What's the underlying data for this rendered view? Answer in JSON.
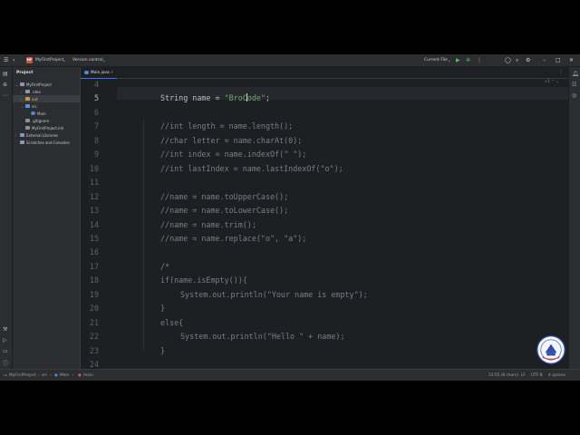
{
  "titlebar": {
    "project_badge": "MF",
    "project_name": "MyFirstProject",
    "vcs": "Version control",
    "run_config": "Current File"
  },
  "project_panel": {
    "title": "Project",
    "tree": [
      {
        "label": "MyFirstProject",
        "depth": 0,
        "arrow": "open",
        "icon": "folder-icon",
        "color": "#8a97b0"
      },
      {
        "label": ".idea",
        "depth": 1,
        "arrow": "closed",
        "icon": "folder-icon",
        "color": "#8a97b0"
      },
      {
        "label": "out",
        "depth": 1,
        "arrow": "closed",
        "icon": "folder-icon",
        "color": "#c69a3c",
        "selected": true
      },
      {
        "label": "src",
        "depth": 1,
        "arrow": "open",
        "icon": "folder-icon",
        "color": "#5b8fd6"
      },
      {
        "label": "Main",
        "depth": 2,
        "arrow": "",
        "icon": "class-icon",
        "color": "#4a8ad6"
      },
      {
        "label": ".gitignore",
        "depth": 1,
        "arrow": "",
        "icon": "file-icon",
        "color": "#8c8f94"
      },
      {
        "label": "MyFirstProject.iml",
        "depth": 1,
        "arrow": "",
        "icon": "file-icon",
        "color": "#8c8f94"
      },
      {
        "label": "External Libraries",
        "depth": 0,
        "arrow": "closed",
        "icon": "library-icon",
        "color": "#8a97b0"
      },
      {
        "label": "Scratches and Consoles",
        "depth": 0,
        "arrow": "",
        "icon": "scratch-icon",
        "color": "#8a97b0"
      }
    ]
  },
  "editor": {
    "tab_label": "Main.java",
    "warning_count": "1",
    "current_line": "5",
    "lines": [
      {
        "n": "4",
        "tokens": []
      },
      {
        "n": "5",
        "indent": 2,
        "tokens": [
          {
            "t": "String name = ",
            "c": ""
          },
          {
            "t": "\"BroC",
            "c": "str"
          },
          {
            "t": "|",
            "c": "caret"
          },
          {
            "t": "ode\"",
            "c": "str"
          },
          {
            "t": ";",
            "c": ""
          }
        ]
      },
      {
        "n": "6",
        "tokens": []
      },
      {
        "n": "7",
        "indent": 2,
        "tokens": [
          {
            "t": "//int length = name.length();",
            "c": "cm"
          }
        ]
      },
      {
        "n": "8",
        "indent": 2,
        "tokens": [
          {
            "t": "//char letter = name.charAt(0);",
            "c": "cm"
          }
        ]
      },
      {
        "n": "9",
        "indent": 2,
        "tokens": [
          {
            "t": "//int index = name.indexOf(\" \");",
            "c": "cm"
          }
        ]
      },
      {
        "n": "10",
        "indent": 2,
        "tokens": [
          {
            "t": "//int lastIndex = name.lastIndexOf(\"o\");",
            "c": "cm"
          }
        ]
      },
      {
        "n": "11",
        "tokens": []
      },
      {
        "n": "12",
        "indent": 2,
        "tokens": [
          {
            "t": "//name = name.toUpperCase();",
            "c": "cm"
          }
        ]
      },
      {
        "n": "13",
        "indent": 2,
        "tokens": [
          {
            "t": "//name = name.toLowerCase();",
            "c": "cm"
          }
        ]
      },
      {
        "n": "14",
        "indent": 2,
        "tokens": [
          {
            "t": "//name = name.trim();",
            "c": "cm"
          }
        ]
      },
      {
        "n": "15",
        "indent": 2,
        "tokens": [
          {
            "t": "//name = name.replace(\"o\", \"a\");",
            "c": "cm"
          }
        ]
      },
      {
        "n": "16",
        "tokens": []
      },
      {
        "n": "17",
        "indent": 2,
        "tokens": [
          {
            "t": "/*",
            "c": "cm"
          }
        ]
      },
      {
        "n": "18",
        "indent": 2,
        "tokens": [
          {
            "t": "if(name.isEmpty()){",
            "c": "cm"
          }
        ]
      },
      {
        "n": "19",
        "indent": 3,
        "tokens": [
          {
            "t": "System.out.println(\"Your name is empty\");",
            "c": "cm"
          }
        ]
      },
      {
        "n": "20",
        "indent": 2,
        "tokens": [
          {
            "t": "}",
            "c": "cm"
          }
        ]
      },
      {
        "n": "21",
        "indent": 2,
        "tokens": [
          {
            "t": "else{",
            "c": "cm"
          }
        ]
      },
      {
        "n": "22",
        "indent": 3,
        "tokens": [
          {
            "t": "System.out.println(\"Hello \" + name);",
            "c": "cm"
          }
        ]
      },
      {
        "n": "23",
        "indent": 2,
        "tokens": [
          {
            "t": "}",
            "c": "cm"
          }
        ]
      },
      {
        "n": "24",
        "tokens": []
      }
    ]
  },
  "statusbar": {
    "breadcrumb": [
      "MyFirstProject",
      "src",
      "Main",
      "main"
    ],
    "position": "23:55 (8 chars)",
    "line_sep": "LF",
    "encoding": "UTF-8",
    "indent": "4 spaces"
  },
  "colors": {
    "accent": "#3574f0",
    "string": "#6aab73",
    "comment": "#7a7e85",
    "keyword": "#cf8e6d"
  }
}
